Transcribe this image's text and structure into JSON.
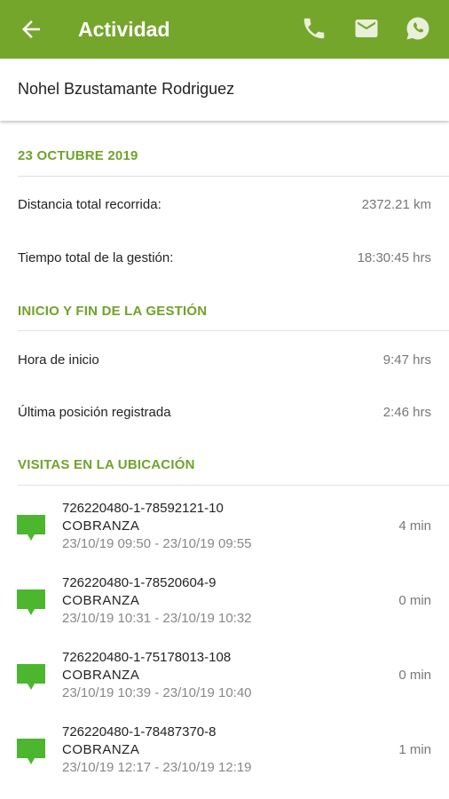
{
  "appbar": {
    "title": "Actividad",
    "back_icon": "arrow-back-icon",
    "actions": [
      "phone-icon",
      "mail-icon",
      "whatsapp-icon"
    ],
    "bg_color": "#75a62c"
  },
  "person": {
    "name": "Nohel Bzustamante Rodriguez"
  },
  "summary": {
    "date_header": "23 OCTUBRE 2019",
    "distance_label": "Distancia total recorrida:",
    "distance_value": "2372.21 km",
    "time_label": "Tiempo total de la gestión:",
    "time_value": "18:30:45 hrs"
  },
  "management": {
    "header": "INICIO Y FIN DE LA GESTIÓN",
    "start_label": "Hora de inicio",
    "start_value": "9:47 hrs",
    "last_label": "Última posición registrada",
    "last_value": "2:46 hrs"
  },
  "visits": {
    "header": "VISITAS EN LA UBICACIÓN",
    "icon": "chat-bubble-icon",
    "accent_color": "#4cb62f",
    "items": [
      {
        "code": "726220480-1-78592121-10",
        "type": "COBRANZA",
        "range": "23/10/19 09:50 - 23/10/19 09:55",
        "duration": "4 min"
      },
      {
        "code": "726220480-1-78520604-9",
        "type": "COBRANZA",
        "range": "23/10/19 10:31 - 23/10/19 10:32",
        "duration": "0 min"
      },
      {
        "code": "726220480-1-75178013-108",
        "type": "COBRANZA",
        "range": "23/10/19 10:39 - 23/10/19 10:40",
        "duration": "0 min"
      },
      {
        "code": "726220480-1-78487370-8",
        "type": "COBRANZA",
        "range": "23/10/19 12:17 - 23/10/19 12:19",
        "duration": "1 min"
      }
    ]
  }
}
